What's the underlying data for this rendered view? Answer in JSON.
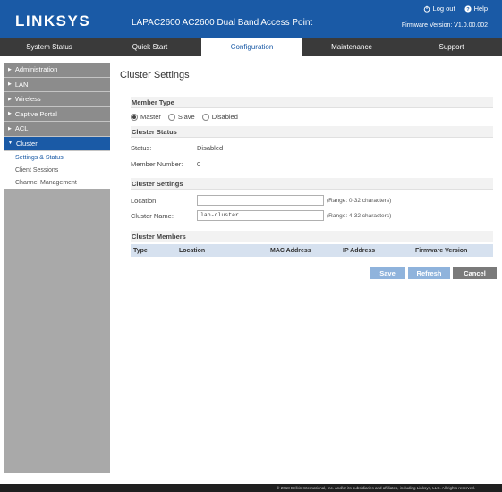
{
  "header": {
    "logo": "LINKSYS",
    "product": "LAPAC2600 AC2600 Dual Band Access Point",
    "logout": "Log out",
    "help": "Help",
    "firmware": "Firmware Version: V1.0.00.002"
  },
  "nav": {
    "items": [
      {
        "label": "System Status",
        "active": false
      },
      {
        "label": "Quick Start",
        "active": false
      },
      {
        "label": "Configuration",
        "active": true
      },
      {
        "label": "Maintenance",
        "active": false
      },
      {
        "label": "Support",
        "active": false
      }
    ]
  },
  "sidebar": {
    "items": [
      {
        "label": "Administration"
      },
      {
        "label": "LAN"
      },
      {
        "label": "Wireless"
      },
      {
        "label": "Captive Portal"
      },
      {
        "label": "ACL"
      },
      {
        "label": "Cluster"
      }
    ],
    "sub_items": [
      {
        "label": "Settings & Status"
      },
      {
        "label": "Client Sessions"
      },
      {
        "label": "Channel Management"
      }
    ]
  },
  "page": {
    "title": "Cluster Settings",
    "member_type": {
      "heading": "Member Type",
      "options": [
        "Master",
        "Slave",
        "Disabled"
      ],
      "selected": "Master"
    },
    "cluster_status": {
      "heading": "Cluster Status",
      "status_label": "Status:",
      "status_value": "Disabled",
      "member_label": "Member Number:",
      "member_value": "0"
    },
    "cluster_settings": {
      "heading": "Cluster Settings",
      "location_label": "Location:",
      "location_value": "",
      "location_hint": "(Range: 0-32 characters)",
      "name_label": "Cluster Name:",
      "name_value": "lap-cluster",
      "name_hint": "(Range: 4-32 characters)"
    },
    "cluster_members": {
      "heading": "Cluster Members",
      "columns": [
        "Type",
        "Location",
        "MAC Address",
        "IP Address",
        "Firmware Version"
      ]
    },
    "buttons": {
      "save": "Save",
      "refresh": "Refresh",
      "cancel": "Cancel"
    }
  },
  "footer": {
    "text": "© 2018 Belkin International, Inc. and/or its subsidiaries and affiliates, including Linksys, LLC. All rights reserved."
  },
  "colors": {
    "brand_blue": "#1a5aa6",
    "nav_dark": "#3a3a3a",
    "sidebar_gray": "#a9a9a9",
    "button_blue": "#8fb3dc",
    "button_gray": "#7a7a7a"
  }
}
